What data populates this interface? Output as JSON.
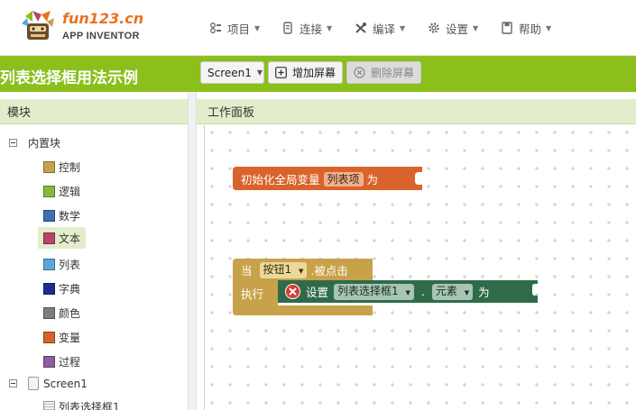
{
  "logo": {
    "title": "fun123.cn",
    "subtitle": "APP INVENTOR"
  },
  "menu": [
    {
      "icon": "project-icon",
      "label": "项目"
    },
    {
      "icon": "connect-icon",
      "label": "连接"
    },
    {
      "icon": "build-icon",
      "label": "编译"
    },
    {
      "icon": "settings-icon",
      "label": "设置"
    },
    {
      "icon": "help-icon",
      "label": "帮助"
    }
  ],
  "project": {
    "name": "列表选择框用法示例",
    "screen_select": "Screen1",
    "add_screen": "增加屏幕",
    "remove_screen": "删除屏幕"
  },
  "blocks_panel": {
    "title": "模块",
    "builtin": "内置块",
    "categories": [
      {
        "label": "控制",
        "color": "#c8a24a"
      },
      {
        "label": "逻辑",
        "color": "#8bb83c"
      },
      {
        "label": "数学",
        "color": "#3f6fb4"
      },
      {
        "label": "文本",
        "color": "#b8446a"
      },
      {
        "label": "列表",
        "color": "#5ba8d8"
      },
      {
        "label": "字典",
        "color": "#1f2c8f"
      },
      {
        "label": "颜色",
        "color": "#7d7d7d"
      },
      {
        "label": "变量",
        "color": "#d9632a"
      },
      {
        "label": "过程",
        "color": "#8e5ea0"
      }
    ],
    "screen": "Screen1",
    "component": "列表选择框1"
  },
  "workspace": {
    "title": "工作面板",
    "global_var": {
      "prefix": "初始化全局变量",
      "name": "列表项",
      "suffix": "为"
    },
    "event": {
      "when": "当",
      "component": "按钮1",
      "event": ".被点击",
      "do": "执行",
      "set": "设置",
      "target": "列表选择框1",
      "dot": ".",
      "property": "元素",
      "to": "为"
    }
  },
  "colors": {
    "accent_green": "#8bbf1b",
    "variable_block": "#d9632a",
    "event_block": "#c8a24a",
    "setter_block": "#2f6b49",
    "logo_orange": "#e8731e"
  }
}
